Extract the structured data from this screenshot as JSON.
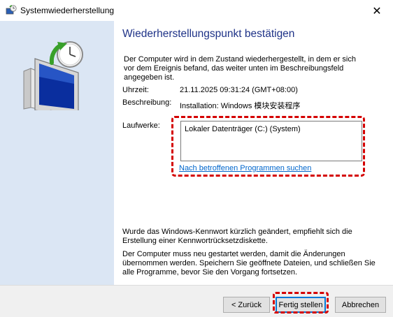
{
  "window": {
    "title": "Systemwiederherstellung",
    "close_glyph": "✕"
  },
  "page": {
    "heading": "Wiederherstellungspunkt bestätigen",
    "intro": "Der Computer wird in dem Zustand wiederhergestellt, in dem er sich vor dem Ereignis befand, das weiter unten im Beschreibungsfeld angegeben ist.",
    "time_label": "Uhrzeit:",
    "time_value": "21.11.2025 09:31:24 (GMT+08:00)",
    "description_label": "Beschreibung:",
    "description_value": "Installation: Windows 模块安装程序",
    "drives_label": "Laufwerke:",
    "drives": [
      "Lokaler Datenträger (C:) (System)"
    ],
    "affected_programs_link": "Nach betroffenen Programmen suchen",
    "password_note": "Wurde das Windows-Kennwort kürzlich geändert, empfiehlt sich die Erstellung einer Kennwortrücksetzdiskette.",
    "restart_note": "Der Computer muss neu gestartet werden, damit die Änderungen übernommen werden. Speichern Sie geöffnete Dateien, und schließen Sie alle Programme, bevor Sie den Vorgang fortsetzen."
  },
  "buttons": {
    "back_label": "< Zurück",
    "finish_label": "Fertig stellen",
    "cancel_label": "Abbrechen"
  },
  "colors": {
    "heading": "#1e3287",
    "sidebar": "#dbe6f4",
    "highlight": "#d40000",
    "link": "#0066cc"
  },
  "icons": {
    "title": "system-restore-icon",
    "sidebar": "computer-restore-icon"
  }
}
